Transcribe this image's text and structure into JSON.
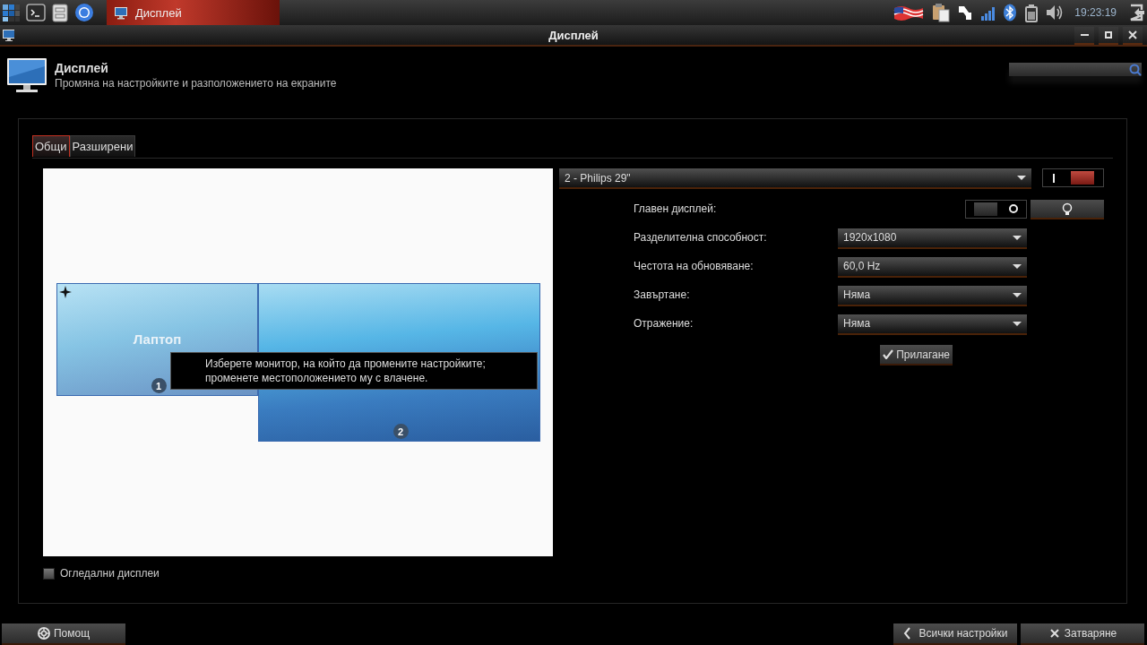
{
  "taskbar": {
    "task": {
      "label": "Дисплей",
      "selected": true
    },
    "clock": "19:23:19"
  },
  "window": {
    "title": "Дисплей"
  },
  "header": {
    "title": "Дисплей",
    "subtitle": "Промяна на настройките и разположението на екраните"
  },
  "tabs": [
    {
      "label": "Общи",
      "selected": true
    },
    {
      "label": "Разширени",
      "selected": false
    }
  ],
  "arrangement": {
    "monitors": [
      {
        "label": "Лаптоп",
        "number": "1",
        "primary": true
      },
      {
        "number": "2",
        "primary": false
      }
    ],
    "tooltip": "Изберете монитор, на който да промените настройките; променете местоположението му с влачене."
  },
  "monitor_select": {
    "value": "2 - Philips 29\"",
    "on": true
  },
  "settings": [
    {
      "kind": "toggle",
      "label": "Главен дисплей:",
      "on": false
    },
    {
      "kind": "combo",
      "label": "Разделителна способност:",
      "value": "1920x1080"
    },
    {
      "kind": "combo",
      "label": "Честота на обновяване:",
      "value": "60,0 Hz"
    },
    {
      "kind": "combo",
      "label": "Завъртане:",
      "value": "Няма"
    },
    {
      "kind": "combo",
      "label": "Отражение:",
      "value": "Няма"
    }
  ],
  "apply_button": "Прилагане",
  "mirror": {
    "label": "Огледални дисплеи",
    "checked": false
  },
  "buttons": [
    {
      "kind": "help",
      "label": "Помощ"
    },
    {
      "kind": "back",
      "label": "Всички настройки"
    },
    {
      "kind": "close",
      "label": "Затваряне"
    }
  ]
}
